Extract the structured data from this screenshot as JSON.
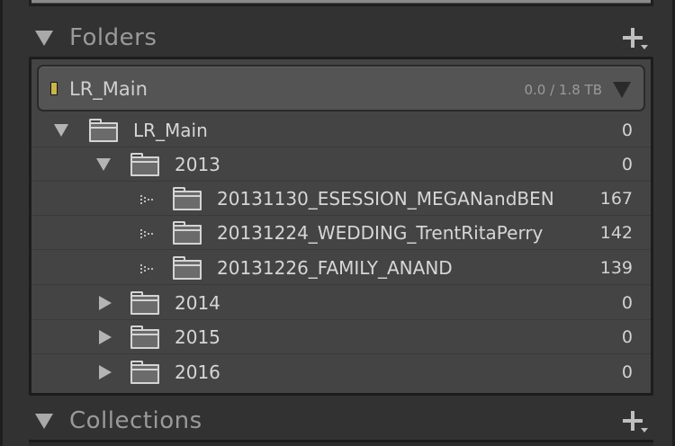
{
  "folders_section": {
    "title": "Folders",
    "add_icon": "plus-dropdown-icon"
  },
  "volume": {
    "name": "LR_Main",
    "size": "0.0 / 1.8 TB",
    "indicator_color": "#c8b64a"
  },
  "tree": [
    {
      "label": "LR_Main",
      "count": "0",
      "level": 0,
      "state": "expanded"
    },
    {
      "label": "2013",
      "count": "0",
      "level": 1,
      "state": "expanded"
    },
    {
      "label": "20131130_ESESSION_MEGANandBEN",
      "count": "167",
      "level": 2,
      "state": "leaf"
    },
    {
      "label": "20131224_WEDDING_TrentRitaPerry",
      "count": "142",
      "level": 2,
      "state": "leaf"
    },
    {
      "label": "20131226_FAMILY_ANAND",
      "count": "139",
      "level": 2,
      "state": "leaf"
    },
    {
      "label": "2014",
      "count": "0",
      "level": 1,
      "state": "collapsed"
    },
    {
      "label": "2015",
      "count": "0",
      "level": 1,
      "state": "collapsed"
    },
    {
      "label": "2016",
      "count": "0",
      "level": 1,
      "state": "collapsed"
    }
  ],
  "collections_section": {
    "title": "Collections",
    "add_icon": "plus-dropdown-icon"
  }
}
